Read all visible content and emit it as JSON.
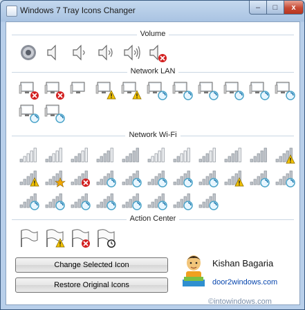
{
  "window": {
    "title": "Windows 7 Tray Icons Changer",
    "close_glyph": "x",
    "min_glyph": "–",
    "max_glyph": "□"
  },
  "sections": {
    "volume": "Volume",
    "network_lan": "Network LAN",
    "network_wifi": "Network Wi-Fi",
    "action_center": "Action Center"
  },
  "buttons": {
    "change": "Change Selected Icon",
    "restore": "Restore Original Icons"
  },
  "author": {
    "name": "Kishan Bagaria",
    "link": "door2windows.com"
  },
  "watermark": "©intowindows.com",
  "icons": {
    "volume": [
      "speaker-round-icon",
      "speaker-muted-waves-0-icon",
      "speaker-waves-1-icon",
      "speaker-waves-2-icon",
      "speaker-waves-3-icon",
      "speaker-muted-icon"
    ],
    "lan": [
      "lan-disconnected-icon",
      "lan-disconnected-icon",
      "lan-icon",
      "lan-warning-icon",
      "lan-warning-icon",
      "lan-busy-icon",
      "lan-busy-icon",
      "lan-busy-icon",
      "lan-busy-icon",
      "lan-busy-icon",
      "lan-busy-icon",
      "lan-busy-icon",
      "lan-busy-icon"
    ],
    "wifi": [
      "wifi-1-icon",
      "wifi-2-icon",
      "wifi-3-icon",
      "wifi-4-icon",
      "wifi-5-icon",
      "wifi-1-icon",
      "wifi-2-icon",
      "wifi-3-icon",
      "wifi-4-icon",
      "wifi-5-icon",
      "wifi-warning-icon",
      "wifi-warning-icon",
      "wifi-star-icon",
      "wifi-disconnected-icon",
      "wifi-busy-icon",
      "wifi-busy-icon",
      "wifi-busy-icon",
      "wifi-busy-icon",
      "wifi-busy-icon",
      "wifi-warning-icon",
      "wifi-busy-icon",
      "wifi-busy-icon",
      "wifi-busy-icon",
      "wifi-busy-icon",
      "wifi-busy-icon",
      "wifi-busy-icon",
      "wifi-busy-icon",
      "wifi-busy-icon",
      "wifi-busy-icon",
      "wifi-busy-icon"
    ],
    "action": [
      "flag-icon",
      "flag-warning-icon",
      "flag-error-icon",
      "flag-clock-icon"
    ]
  }
}
